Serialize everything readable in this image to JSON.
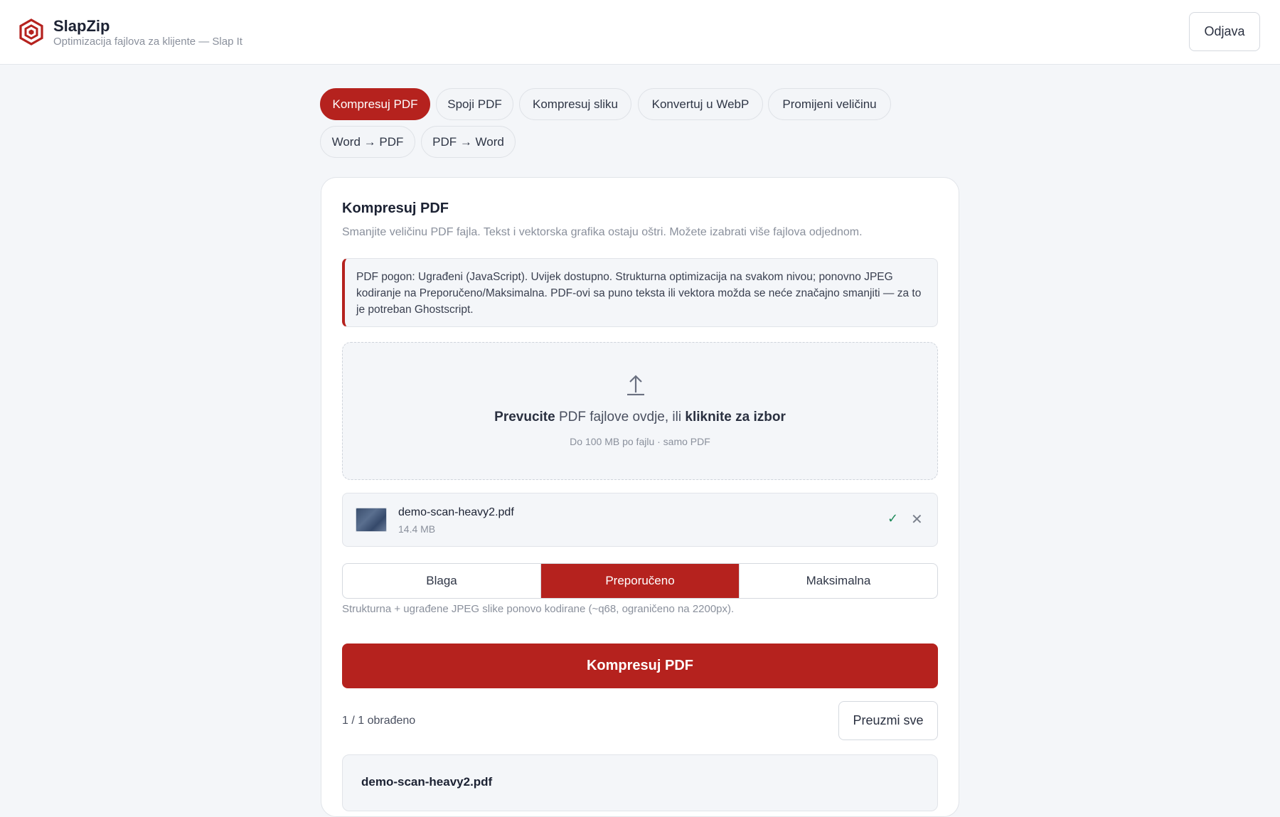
{
  "header": {
    "title": "SlapZip",
    "subtitle": "Optimizacija fajlova za klijente — Slap It",
    "logout_label": "Odjava",
    "brand_color": "#b5221e"
  },
  "tabs": [
    {
      "label": "Kompresuj PDF",
      "active": true
    },
    {
      "label": "Spoji PDF",
      "active": false
    },
    {
      "label": "Kompresuj sliku",
      "active": false
    },
    {
      "label": "Konvertuj u WebP",
      "active": false
    },
    {
      "label": "Promijeni veličinu",
      "active": false
    },
    {
      "label": "Word → PDF",
      "active": false
    },
    {
      "label": "PDF → Word",
      "active": false
    }
  ],
  "card": {
    "title": "Kompresuj PDF",
    "description": "Smanjite veličinu PDF fajla. Tekst i vektorska grafika ostaju oštri. Možete izabrati više fajlova odjednom.",
    "info": "PDF pogon: Ugrađeni (JavaScript). Uvijek dostupno. Strukturna optimizacija na svakom nivou; ponovno JPEG kodiranje na Preporučeno/Maksimalna. PDF-ovi sa puno teksta ili vektora možda se neće značajno smanjiti — za to je potreban Ghostscript."
  },
  "dropzone": {
    "icon": "upload-icon",
    "text_bold_1": "Prevucite",
    "text_mid": " PDF fajlove ovdje, ili ",
    "text_bold_2": "kliknite za izbor",
    "hint": "Do 100 MB po fajlu · samo PDF"
  },
  "file": {
    "name": "demo-scan-heavy2.pdf",
    "size": "14.4 MB",
    "status_icon": "check-icon",
    "remove_icon": "close-icon"
  },
  "levels": {
    "options": [
      "Blaga",
      "Preporučeno",
      "Maksimalna"
    ],
    "selected": "Preporučeno",
    "hint": "Strukturna + ugrađene JPEG slike ponovo kodirane (~q68, ograničeno na 2200px)."
  },
  "actions": {
    "compress_label": "Kompresuj PDF",
    "processed": "1 / 1 obrađeno",
    "download_all_label": "Preuzmi sve"
  },
  "results": [
    {
      "name": "demo-scan-heavy2.pdf"
    }
  ]
}
